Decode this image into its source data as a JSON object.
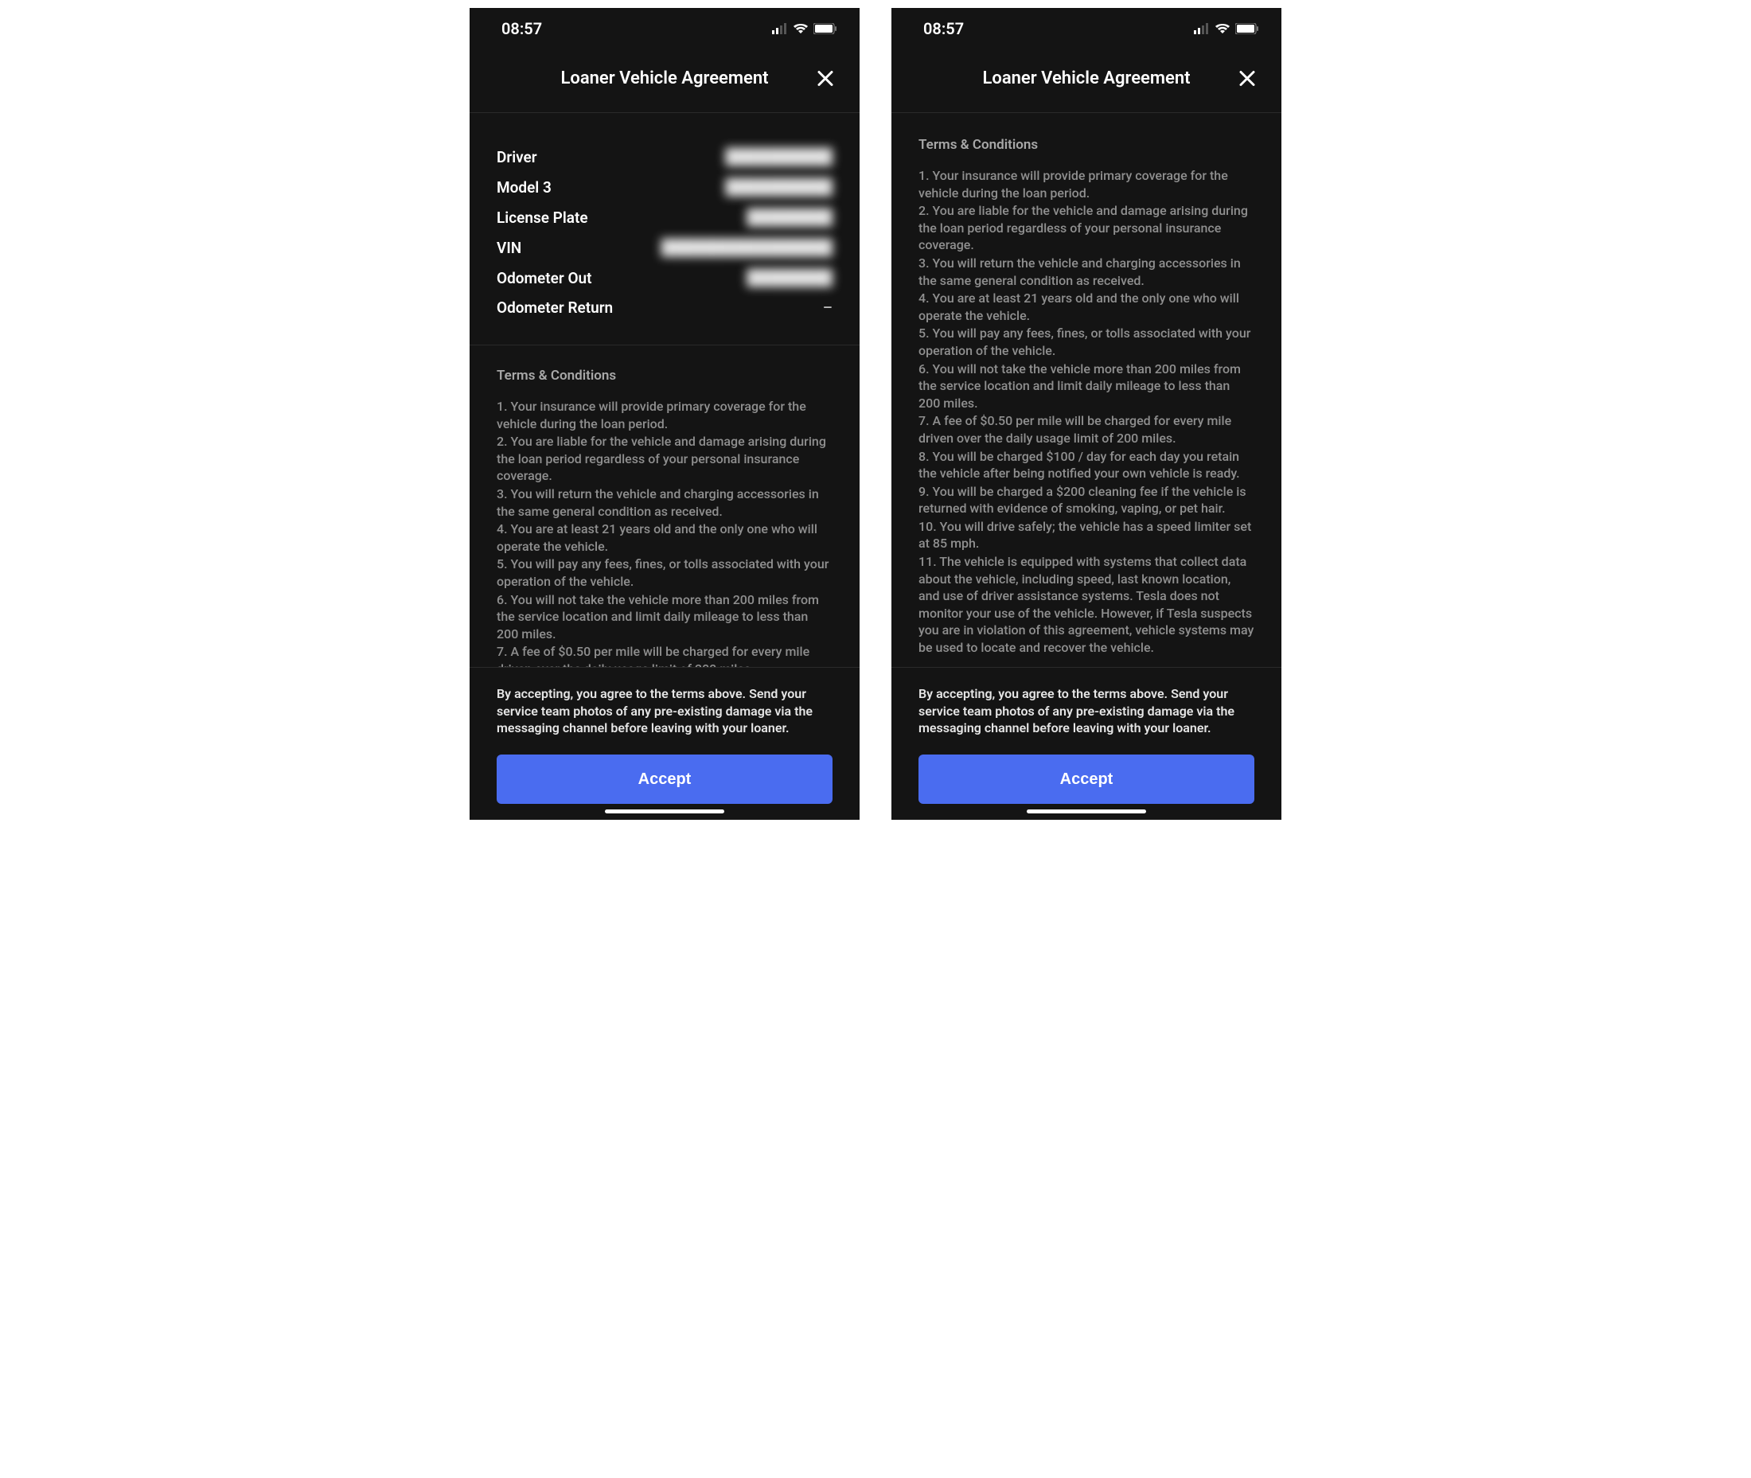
{
  "status": {
    "time": "08:57"
  },
  "header": {
    "title": "Loaner Vehicle Agreement"
  },
  "details": {
    "rows": [
      {
        "label": "Driver",
        "value": "██████████",
        "blur": true
      },
      {
        "label": "Model 3",
        "value": "██████████",
        "blur": true
      },
      {
        "label": "License Plate",
        "value": "████████",
        "blur": true
      },
      {
        "label": "VIN",
        "value": "████████████████",
        "blur": true
      },
      {
        "label": "Odometer Out",
        "value": "████████",
        "blur": true
      },
      {
        "label": "Odometer Return",
        "value": "–",
        "blur": false
      }
    ]
  },
  "terms": {
    "heading": "Terms & Conditions",
    "items": [
      "1. Your insurance will provide primary coverage for the vehicle during the loan period.",
      "2. You are liable for the vehicle and damage arising during the loan period regardless of your personal insurance coverage.",
      "3. You will return the vehicle and charging accessories in the same general condition as received.",
      "4. You are at least 21 years old and the only one who will operate the vehicle.",
      "5. You will pay any fees, fines, or tolls associated with your operation of the vehicle.",
      "6. You will not take the vehicle more than 200 miles from the service location and limit daily mileage to less than 200 miles.",
      "7. A fee of $0.50 per mile will be charged for every mile driven over the daily usage limit of 200 miles.",
      "8. You will be charged $100 / day for each day you retain the vehicle after being notified your own vehicle is ready.",
      "9. You will be charged a $200 cleaning fee if the vehicle is returned with evidence of smoking, vaping, or pet hair.",
      "10. You will drive safely; the vehicle has a speed limiter set at 85 mph.",
      "11. The vehicle is equipped with systems that collect data about the vehicle, including speed, last known location, and use of driver assistance systems. Tesla does not monitor your use of the vehicle. However, if Tesla suspects you are in violation of this agreement, vehicle systems may be used to locate and recover the vehicle."
    ]
  },
  "footer": {
    "text": "By accepting, you agree to the terms above. Send your service team photos of any pre-existing damage via the messaging channel before leaving with your loaner.",
    "accept_label": "Accept"
  }
}
